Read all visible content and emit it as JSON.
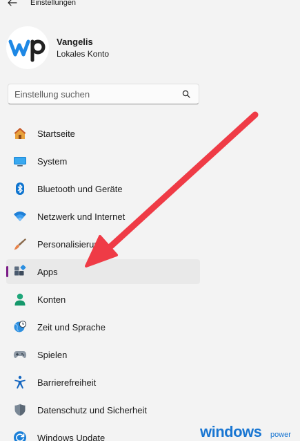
{
  "window": {
    "title": "Einstellungen"
  },
  "profile": {
    "name": "Vangelis",
    "account_type": "Lokales Konto",
    "avatar_text": "wp"
  },
  "search": {
    "placeholder": "Einstellung suchen"
  },
  "nav": {
    "items": [
      {
        "label": "Startseite",
        "icon": "home-icon"
      },
      {
        "label": "System",
        "icon": "monitor-icon"
      },
      {
        "label": "Bluetooth und Geräte",
        "icon": "bluetooth-icon"
      },
      {
        "label": "Netzwerk und Internet",
        "icon": "wifi-icon"
      },
      {
        "label": "Personalisierung",
        "icon": "brush-icon"
      },
      {
        "label": "Apps",
        "icon": "apps-icon",
        "active": true
      },
      {
        "label": "Konten",
        "icon": "person-icon"
      },
      {
        "label": "Zeit und Sprache",
        "icon": "globe-clock-icon"
      },
      {
        "label": "Spielen",
        "icon": "gamepad-icon"
      },
      {
        "label": "Barrierefreiheit",
        "icon": "accessibility-icon"
      },
      {
        "label": "Datenschutz und Sicherheit",
        "icon": "shield-icon"
      },
      {
        "label": "Windows Update",
        "icon": "update-icon"
      }
    ]
  },
  "colors": {
    "accent": "#7a1a86",
    "arrow": "#ef3b46",
    "watermark": "#1976d2"
  },
  "watermark": {
    "main": "windows",
    "sub": "power"
  }
}
